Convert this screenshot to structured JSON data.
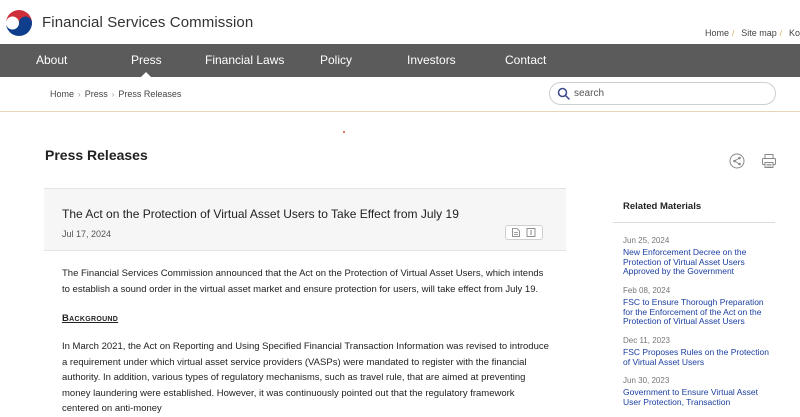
{
  "header": {
    "brand": "Financial Services Commission",
    "util_links": [
      "Home",
      "Site map",
      "Ko"
    ]
  },
  "nav": {
    "items": [
      {
        "label": "About"
      },
      {
        "label": "Press",
        "active": true
      },
      {
        "label": "Financial Laws"
      },
      {
        "label": "Policy"
      },
      {
        "label": "Investors"
      },
      {
        "label": "Contact"
      }
    ]
  },
  "breadcrumb": [
    "Home",
    "Press",
    "Press Releases"
  ],
  "search": {
    "placeholder": "search"
  },
  "page": {
    "title": "Press Releases"
  },
  "article": {
    "title": "The Act on the Protection of Virtual Asset Users to Take Effect from July 19",
    "date": "Jul 17, 2024",
    "intro": "The Financial Services Commission announced that the Act on the Protection of Virtual Asset Users, which intends to establish a sound order in the virtual asset market and ensure protection for users, will take effect from July 19.",
    "background_heading": "Background",
    "background_text": "In March 2021, the Act on Reporting and Using Specified Financial Transaction Information was revised to introduce a requirement under which virtual asset service providers (VASPs) were mandated to register with the financial authority. In addition, various types of regulatory mechanisms, such as travel rule, that are aimed at preventing money laundering were established. However, it was continuously pointed out that the regulatory framework centered on anti-money"
  },
  "sidebar": {
    "title": "Related Materials",
    "items": [
      {
        "date": "Jun 25, 2024",
        "title": "New Enforcement Decree on the Protection of Virtual Asset Users Approved by the Government"
      },
      {
        "date": "Feb 08, 2024",
        "title": "FSC to Ensure Thorough Preparation for the Enforcement of the Act on the Protection of Virtual Asset Users"
      },
      {
        "date": "Dec 11, 2023",
        "title": "FSC Proposes Rules on the Protection of Virtual Asset Users"
      },
      {
        "date": "Jun 30, 2023",
        "title": "Government to Ensure Virtual Asset User Protection, Transaction"
      }
    ]
  },
  "colors": {
    "nav_bg": "#5b5b5b",
    "accent_gold": "#d9a25a",
    "link_blue": "#1a3fa0",
    "search_icon": "#3a4a8a"
  },
  "icons": [
    "korea-emblem-logo",
    "search-icon",
    "share-icon",
    "print-icon",
    "file-icon",
    "document-icon"
  ]
}
